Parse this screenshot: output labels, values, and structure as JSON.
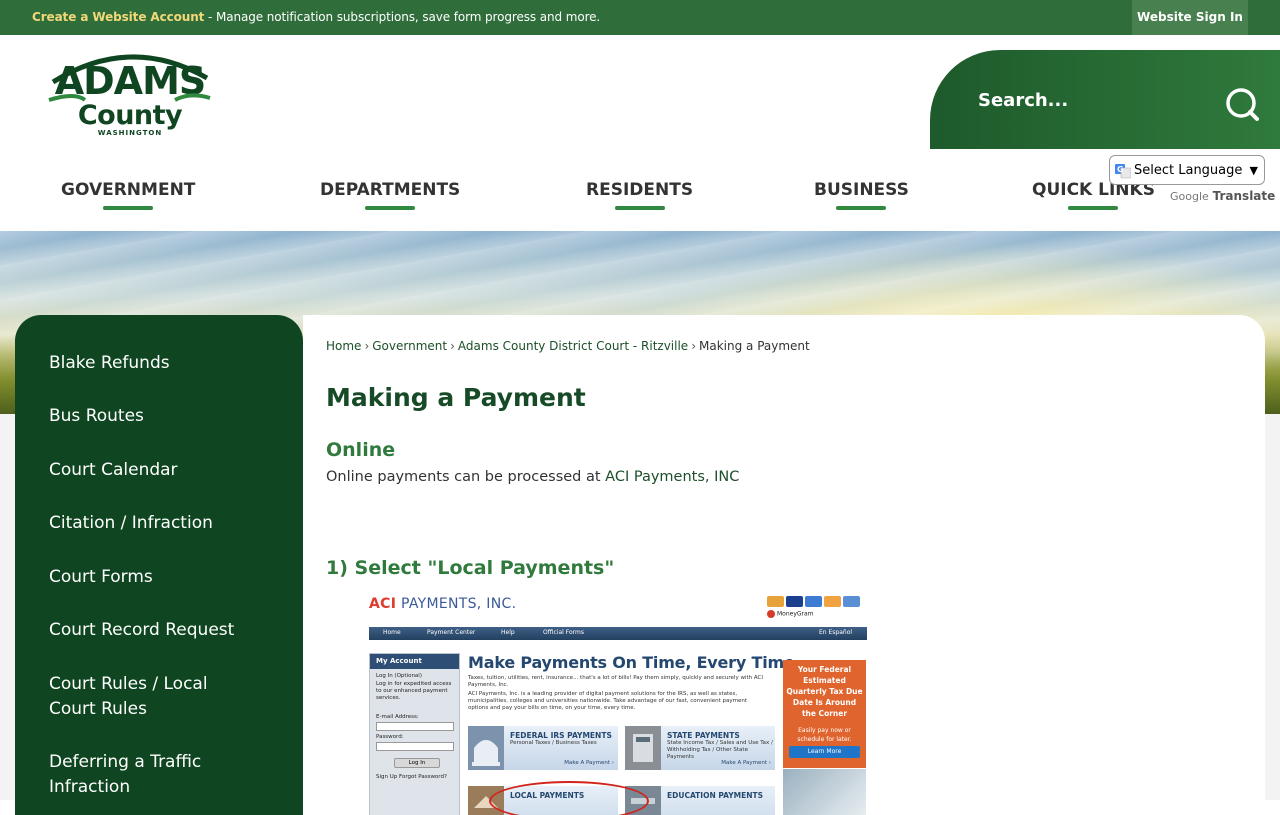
{
  "topbar": {
    "create_account": "Create a Website Account",
    "message": " - Manage notification subscriptions, save form progress and more.",
    "sign_in": "Website Sign In"
  },
  "logo": {
    "line1": "ADAMS",
    "line2": "County",
    "line3": "WASHINGTON"
  },
  "search": {
    "placeholder": "Search..."
  },
  "nav": {
    "items": [
      {
        "label": "GOVERNMENT"
      },
      {
        "label": "DEPARTMENTS"
      },
      {
        "label": "RESIDENTS"
      },
      {
        "label": "BUSINESS"
      },
      {
        "label": "QUICK LINKS"
      }
    ]
  },
  "translate": {
    "select_label": "Select Language",
    "google": "Google",
    "translate": "Translate"
  },
  "sidebar": {
    "items": [
      {
        "label": "Blake Refunds"
      },
      {
        "label": "Bus Routes"
      },
      {
        "label": "Court Calendar"
      },
      {
        "label": "Citation / Infraction"
      },
      {
        "label": "Court Forms"
      },
      {
        "label": "Court Record Request"
      },
      {
        "label": "Court Rules / Local Court Rules"
      },
      {
        "label": "Deferring a Traffic Infraction"
      }
    ]
  },
  "breadcrumb": {
    "items": [
      "Home",
      "Government",
      "Adams County District Court - Ritzville"
    ],
    "current": "Making a Payment",
    "separator": "›"
  },
  "content": {
    "title": "Making a Payment",
    "section": "Online",
    "para_prefix": "Online payments can be processed at ",
    "para_link": "ACI Payments, INC",
    "step1": "1) Select \"Local Payments\""
  },
  "aci": {
    "logo_brand": "ACI",
    "logo_rest": " PAYMENTS, INC.",
    "moneygram": "MoneyGram",
    "nav": [
      "Home",
      "Payment Center",
      "Help",
      "Official Forms",
      "En Español"
    ],
    "account_title": "My Account",
    "login": "Log In (Optional)",
    "login_desc": "Log in for expedited access to our enhanced payment services.",
    "email_label": "E-mail Address:",
    "password_label": "Password:",
    "login_btn": "Log In",
    "signup": "Sign Up  Forgot Password?",
    "headline": "Make Payments On Time, Every Time",
    "text1": "Taxes, tuition, utilities, rent, insurance... that's a lot of bills! Pay them simply, quickly and securely with ACI Payments, Inc.",
    "text2": "ACI Payments, Inc. is a leading provider of digital payment solutions for the IRS, as well as states, municipalities, colleges and universities nationwide. Take advantage of our fast, convenient payment options and pay your bills on time, on your time, every time.",
    "tiles": [
      {
        "title": "FEDERAL IRS PAYMENTS",
        "sub": "Personal Taxes / Business Taxes",
        "link": "Make A Payment ›"
      },
      {
        "title": "STATE PAYMENTS",
        "sub": "State Income Tax / Sales and Use Tax / Withholding Tax / Other State Payments",
        "link": "Make A Payment ›"
      },
      {
        "title": "LOCAL PAYMENTS",
        "sub": "",
        "link": ""
      },
      {
        "title": "EDUCATION PAYMENTS",
        "sub": "",
        "link": ""
      }
    ],
    "promo_title": "Your Federal Estimated Quarterly Tax Due Date Is Around the Corner",
    "promo_sub": "Easily pay now or schedule for later.",
    "promo_btn": "Learn More"
  },
  "colors": {
    "brand_green": "#0f4621",
    "accent_green": "#2f7a3c",
    "topbar": "#2f6e3a",
    "highlight": "#f2d879"
  }
}
